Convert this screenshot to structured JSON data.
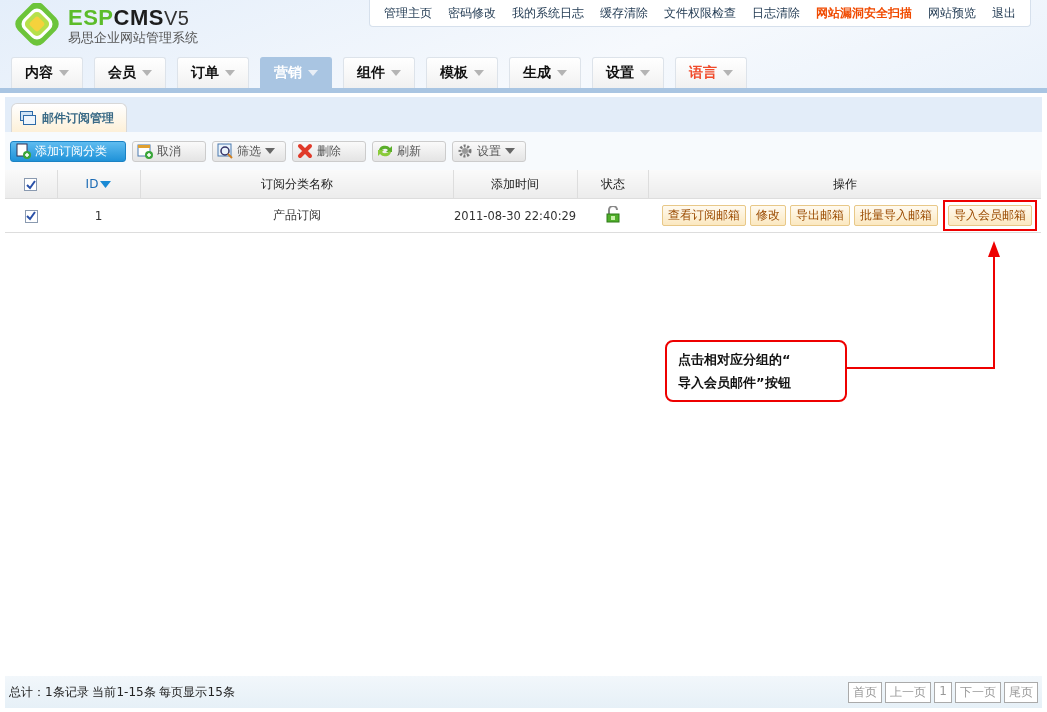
{
  "logo": {
    "brand_left": "ESP",
    "brand_right": "CMS",
    "version": "V5",
    "subtitle": "易思企业网站管理系统"
  },
  "top_links": [
    {
      "label": "管理主页",
      "highlighted": false
    },
    {
      "label": "密码修改",
      "highlighted": false
    },
    {
      "label": "我的系统日志",
      "highlighted": false
    },
    {
      "label": "缓存清除",
      "highlighted": false
    },
    {
      "label": "文件权限检查",
      "highlighted": false
    },
    {
      "label": "日志清除",
      "highlighted": false
    },
    {
      "label": "网站漏洞安全扫描",
      "highlighted": true
    },
    {
      "label": "网站预览",
      "highlighted": false
    },
    {
      "label": "退出",
      "highlighted": false
    }
  ],
  "main_nav": [
    {
      "label": "内容",
      "selected": false,
      "highlighted": false
    },
    {
      "label": "会员",
      "selected": false,
      "highlighted": false
    },
    {
      "label": "订单",
      "selected": false,
      "highlighted": false
    },
    {
      "label": "营销",
      "selected": true,
      "highlighted": false
    },
    {
      "label": "组件",
      "selected": false,
      "highlighted": false
    },
    {
      "label": "模板",
      "selected": false,
      "highlighted": false
    },
    {
      "label": "生成",
      "selected": false,
      "highlighted": false
    },
    {
      "label": "设置",
      "selected": false,
      "highlighted": false
    },
    {
      "label": "语言",
      "selected": false,
      "highlighted": true
    }
  ],
  "panel_tab": "邮件订阅管理",
  "toolbar": [
    {
      "label": "添加订阅分类",
      "kind": "add",
      "primary": true,
      "dropdown": false
    },
    {
      "label": "取消",
      "kind": "cancel",
      "primary": false,
      "dropdown": false
    },
    {
      "label": "筛选",
      "kind": "filter",
      "primary": false,
      "dropdown": true
    },
    {
      "label": "删除",
      "kind": "delete",
      "primary": false,
      "dropdown": false
    },
    {
      "label": "刷新",
      "kind": "refresh",
      "primary": false,
      "dropdown": false
    },
    {
      "label": "设置",
      "kind": "settings",
      "primary": false,
      "dropdown": true
    }
  ],
  "table": {
    "header_checked": true,
    "columns": [
      {
        "label": "ID",
        "sorted": true
      },
      {
        "label": "订阅分类名称",
        "sorted": false
      },
      {
        "label": "添加时间",
        "sorted": false
      },
      {
        "label": "状态",
        "sorted": false
      },
      {
        "label": "操作",
        "sorted": false
      }
    ],
    "rows": [
      {
        "checked": true,
        "id": "1",
        "name": "产品订阅",
        "time": "2011-08-30 22:40:29",
        "unlocked": true,
        "actions": [
          {
            "label": "查看订阅邮箱",
            "highlighted": false
          },
          {
            "label": "修改",
            "highlighted": false
          },
          {
            "label": "导出邮箱",
            "highlighted": false
          },
          {
            "label": "批量导入邮箱",
            "highlighted": false
          },
          {
            "label": "导入会员邮箱",
            "highlighted": true
          }
        ]
      }
    ]
  },
  "callout": {
    "lines": [
      "点击相对应分组的“",
      "导入会员邮件”按钮"
    ]
  },
  "footer": {
    "summary": "总计：1条记录 当前1-15条 每页显示15条",
    "pager": [
      "首页",
      "上一页",
      "1",
      "下一页",
      "尾页"
    ]
  }
}
